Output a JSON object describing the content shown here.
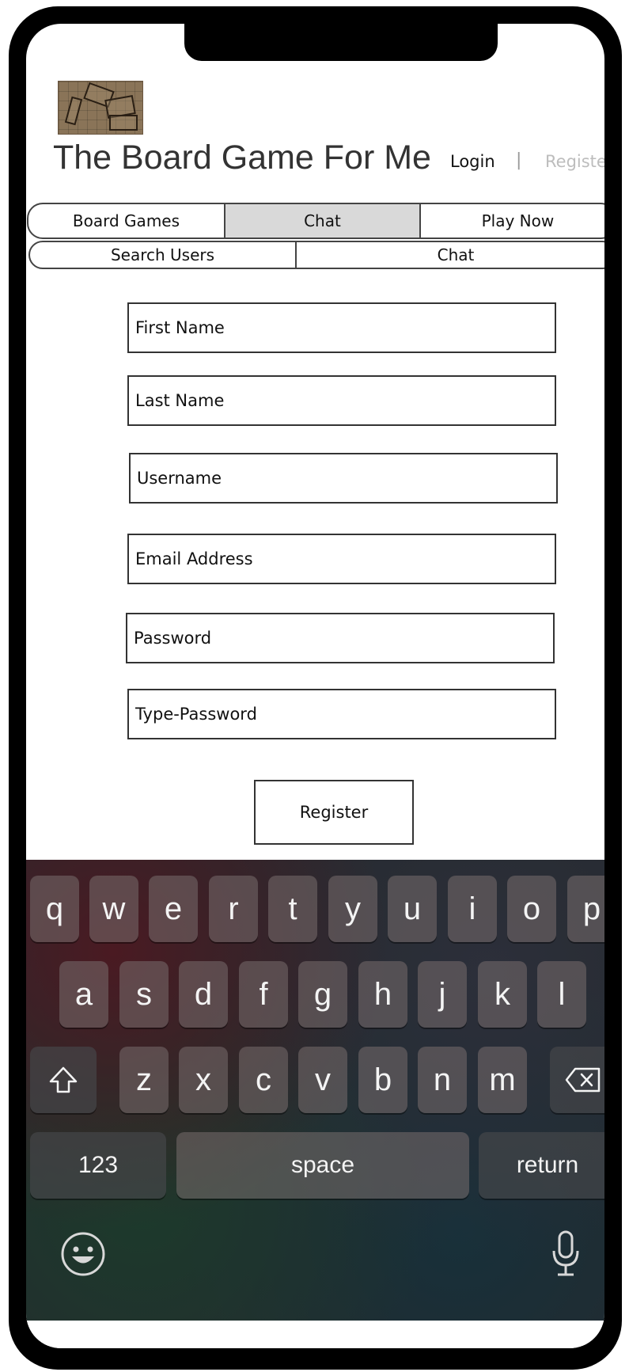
{
  "header": {
    "app_title": "The Board Game For Me",
    "login_label": "Login",
    "divider": "|",
    "register_label": "Register"
  },
  "nav_primary": [
    {
      "label": "Board Games",
      "active": false
    },
    {
      "label": "Chat",
      "active": true
    },
    {
      "label": "Play Now",
      "active": false
    }
  ],
  "nav_secondary": [
    {
      "label": "Search Users"
    },
    {
      "label": "Chat"
    }
  ],
  "form": {
    "first_name_placeholder": "First Name",
    "last_name_placeholder": "Last Name",
    "username_placeholder": "Username",
    "email_placeholder": "Email Address",
    "password_placeholder": "Password",
    "retype_password_placeholder": "Type-Password",
    "submit_label": "Register"
  },
  "keyboard": {
    "row1": [
      "q",
      "w",
      "e",
      "r",
      "t",
      "y",
      "u",
      "i",
      "o",
      "p"
    ],
    "row2": [
      "a",
      "s",
      "d",
      "f",
      "g",
      "h",
      "j",
      "k",
      "l"
    ],
    "row3": [
      "z",
      "x",
      "c",
      "v",
      "b",
      "n",
      "m"
    ],
    "numbers_label": "123",
    "space_label": "space",
    "return_label": "return"
  },
  "colors": {
    "active_tab": "#d9d9d9",
    "register_link": "#bdbdbd"
  }
}
